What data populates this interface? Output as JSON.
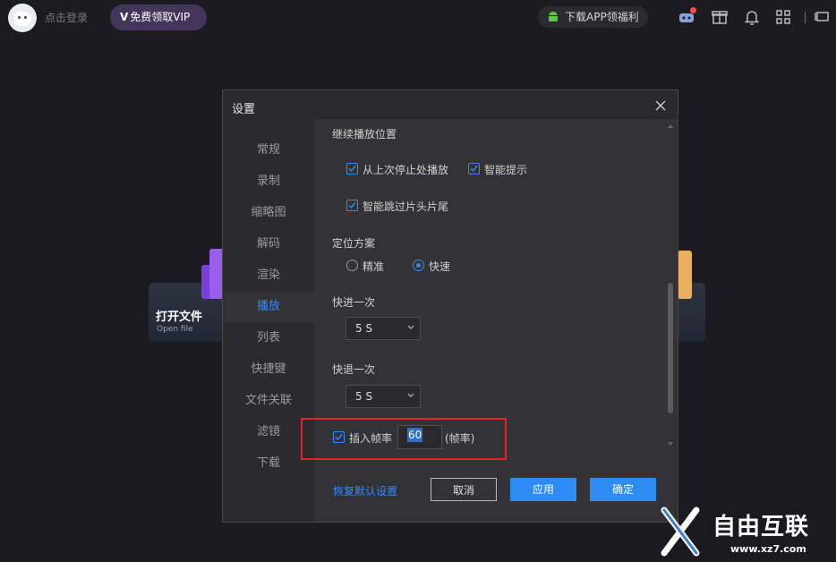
{
  "topbar": {
    "login_label": "点击登录",
    "vip_label": "免费领取VIP",
    "app_label": "下载APP领福利"
  },
  "home": {
    "open_file_title": "打开文件",
    "open_file_sub": "Open file"
  },
  "dialog": {
    "title": "设置",
    "nav": [
      "常规",
      "录制",
      "缩略图",
      "解码",
      "渲染",
      "播放",
      "列表",
      "快捷键",
      "文件关联",
      "滤镜",
      "下载"
    ],
    "active_nav": "播放",
    "section_resume": "继续播放位置",
    "cb_resume": "从上次停止处播放",
    "cb_smart": "智能提示",
    "cb_skip": "智能跳过片头片尾",
    "section_locate": "定位方案",
    "radio_precise": "精准",
    "radio_fast": "快速",
    "section_forward": "快进一次",
    "forward_value": "5 S",
    "section_backward": "快退一次",
    "backward_value": "5 S",
    "cb_framerate": "插入帧率",
    "framerate_value": "60",
    "framerate_unit": "(帧率)",
    "restore_label": "恢复默认设置",
    "cancel_label": "取消",
    "apply_label": "应用",
    "ok_label": "确定"
  },
  "watermark": {
    "brand": "自由互联",
    "url": "www.xz7.com"
  },
  "colors": {
    "accent": "#2f8cff",
    "highlight_box": "#e3242b",
    "vip_bg": "#44365a"
  }
}
